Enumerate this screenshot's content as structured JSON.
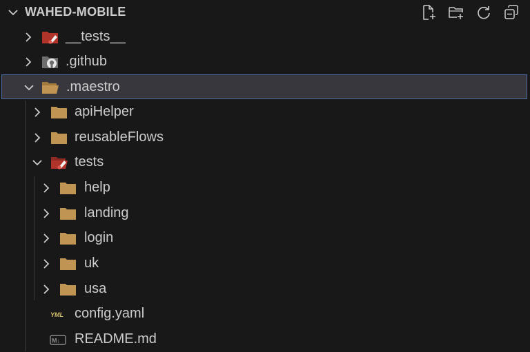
{
  "explorer": {
    "project_title": "WAHED-MOBILE",
    "actions": [
      "new-file",
      "new-folder",
      "refresh",
      "collapse-all"
    ]
  },
  "tree": {
    "items": [
      {
        "label": "__tests__",
        "icon": "test-folder-icon",
        "expanded": false,
        "depth": 0
      },
      {
        "label": ".github",
        "icon": "github-folder-icon",
        "expanded": false,
        "depth": 0
      },
      {
        "label": ".maestro",
        "icon": "folder-open-icon",
        "expanded": true,
        "depth": 0,
        "selected": true
      },
      {
        "label": "apiHelper",
        "icon": "folder-icon",
        "expanded": false,
        "depth": 1
      },
      {
        "label": "reusableFlows",
        "icon": "folder-icon",
        "expanded": false,
        "depth": 1
      },
      {
        "label": "tests",
        "icon": "test-folder-icon",
        "expanded": true,
        "depth": 1
      },
      {
        "label": "help",
        "icon": "folder-icon",
        "expanded": false,
        "depth": 2
      },
      {
        "label": "landing",
        "icon": "folder-icon",
        "expanded": false,
        "depth": 2
      },
      {
        "label": "login",
        "icon": "folder-icon",
        "expanded": false,
        "depth": 2
      },
      {
        "label": "uk",
        "icon": "folder-icon",
        "expanded": false,
        "depth": 2
      },
      {
        "label": "usa",
        "icon": "folder-icon",
        "expanded": false,
        "depth": 2
      },
      {
        "label": "config.yaml",
        "icon": "yaml-file-icon",
        "depth": 1
      },
      {
        "label": "README.md",
        "icon": "markdown-file-icon",
        "depth": 1
      }
    ]
  },
  "icon_labels": {
    "yaml": "YML",
    "markdown": "M↓"
  },
  "colors": {
    "background": "#181818",
    "selection": "#37373d",
    "selection_border": "#4b6ea8",
    "folder": "#c09553",
    "test_folder": "#c0392b",
    "yaml": "#d4c06a"
  }
}
